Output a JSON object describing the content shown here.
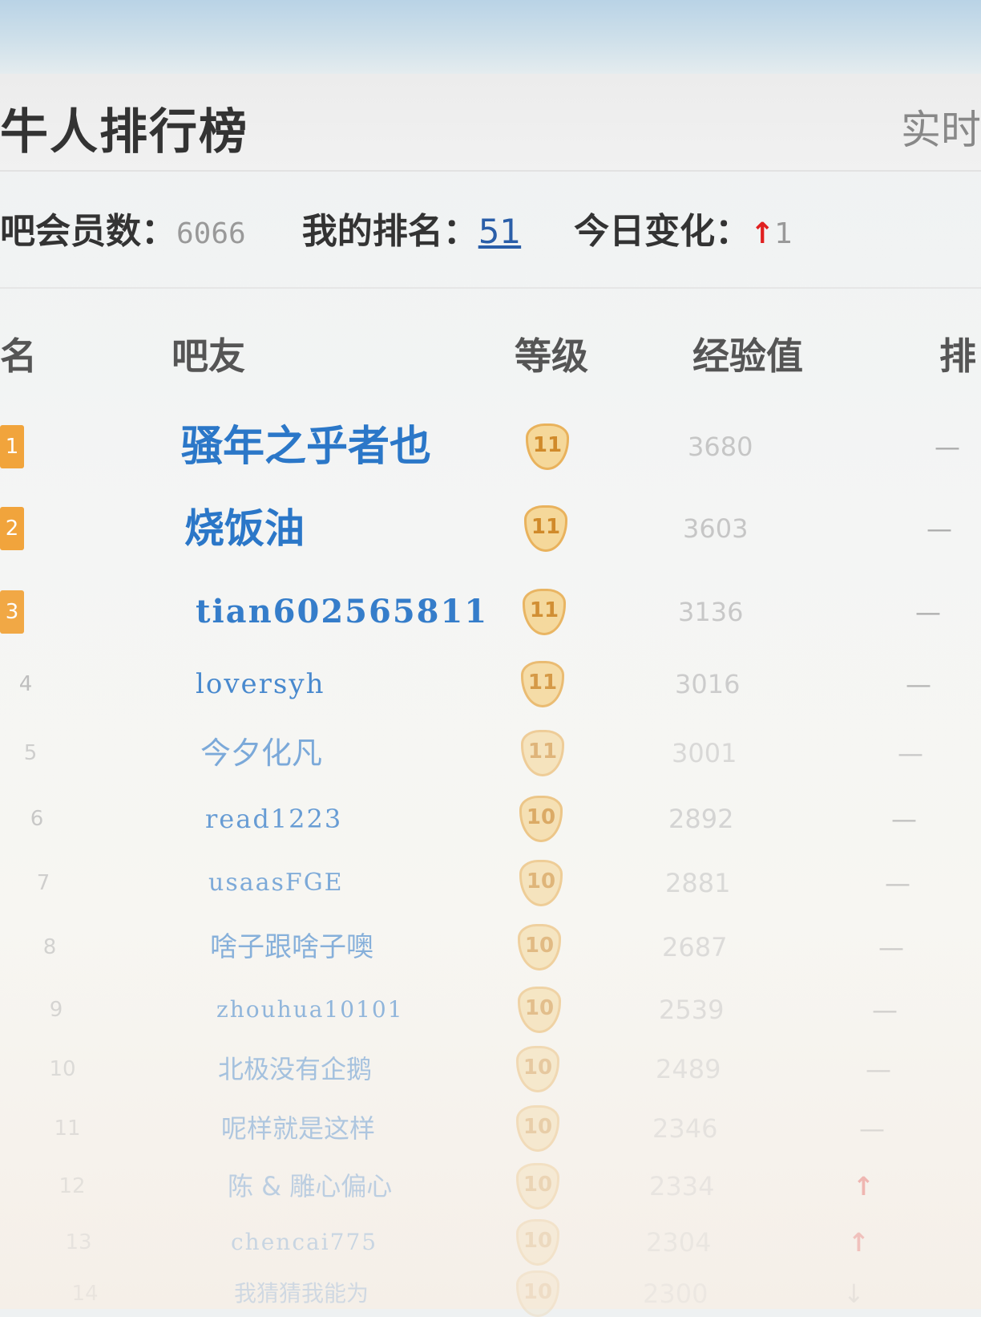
{
  "header": {
    "title": "牛人排行榜",
    "realtime_label": "实时"
  },
  "stats": {
    "members_label": "吧会员数：",
    "members_value": "6066",
    "my_rank_label": "我的排名：",
    "my_rank_value": "51",
    "today_change_label": "今日变化：",
    "today_change_arrow": "↑",
    "today_change_value": "1"
  },
  "columns": {
    "rank": "名",
    "member": "吧友",
    "level": "等级",
    "exp": "经验值",
    "trend": "排"
  },
  "rows": [
    {
      "rank": "1",
      "name": "骚年之乎者也",
      "level": "11",
      "exp": "3680",
      "trend": "—"
    },
    {
      "rank": "2",
      "name": "烧饭油",
      "level": "11",
      "exp": "3603",
      "trend": "—"
    },
    {
      "rank": "3",
      "name": "tian602565811",
      "level": "11",
      "exp": "3136",
      "trend": "—"
    },
    {
      "rank": "4",
      "name": "loversyh",
      "level": "11",
      "exp": "3016",
      "trend": "—"
    },
    {
      "rank": "5",
      "name": "今夕化凡",
      "level": "11",
      "exp": "3001",
      "trend": "—"
    },
    {
      "rank": "6",
      "name": "read1223",
      "level": "10",
      "exp": "2892",
      "trend": "—"
    },
    {
      "rank": "7",
      "name": "usaasFGE",
      "level": "10",
      "exp": "2881",
      "trend": "—"
    },
    {
      "rank": "8",
      "name": "啥子跟啥子噢",
      "level": "10",
      "exp": "2687",
      "trend": "—"
    },
    {
      "rank": "9",
      "name": "zhouhua10101",
      "level": "10",
      "exp": "2539",
      "trend": "—"
    },
    {
      "rank": "10",
      "name": "北极没有企鹅",
      "level": "10",
      "exp": "2489",
      "trend": "—"
    },
    {
      "rank": "11",
      "name": "呢样就是这样",
      "level": "10",
      "exp": "2346",
      "trend": "—"
    },
    {
      "rank": "12",
      "name": "陈 & 雕心偏心",
      "level": "10",
      "exp": "2334",
      "trend": "↑"
    },
    {
      "rank": "13",
      "name": "chencai775",
      "level": "10",
      "exp": "2304",
      "trend": "↑"
    },
    {
      "rank": "14",
      "name": "我猜猜我能为",
      "level": "10",
      "exp": "2300",
      "trend": "↓"
    }
  ]
}
